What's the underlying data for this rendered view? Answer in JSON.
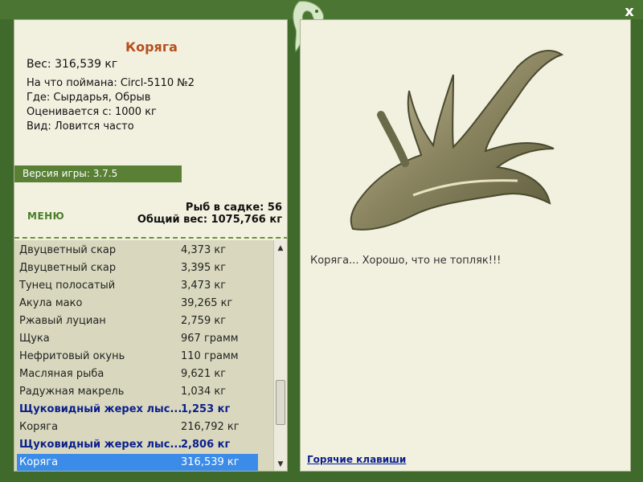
{
  "window": {
    "close_label": "x"
  },
  "catch": {
    "title": "Коряга",
    "weight": "Вес: 316,539 кг",
    "caught_on": "На что поймана: Circl-5110 №2",
    "location": "Где: Сырдарья, Обрыв",
    "value": "Оценивается с: 1000 кг",
    "kind": "Вид: Ловится часто",
    "caption": "Коряга... Хорошо, что не топляк!!!"
  },
  "version": "Версия игры: 3.7.5",
  "menu_label": "МЕНЮ",
  "stats": {
    "fish_in_keepnet": "Рыб в садке: 56",
    "total_weight": "Общий вес: 1075,766 кг"
  },
  "fish_list": [
    {
      "name": "Двуцветный скар",
      "weight": "4,373 кг",
      "style": "normal"
    },
    {
      "name": "Двуцветный скар",
      "weight": "3,395 кг",
      "style": "normal"
    },
    {
      "name": "Тунец полосатый",
      "weight": "3,473 кг",
      "style": "normal"
    },
    {
      "name": "Акула мако",
      "weight": "39,265 кг",
      "style": "normal"
    },
    {
      "name": "Ржавый луциан",
      "weight": "2,759 кг",
      "style": "normal"
    },
    {
      "name": "Щука",
      "weight": "967 грамм",
      "style": "normal"
    },
    {
      "name": "Нефритовый окунь",
      "weight": "110 грамм",
      "style": "normal"
    },
    {
      "name": "Масляная рыба",
      "weight": "9,621 кг",
      "style": "normal"
    },
    {
      "name": "Радужная макрель",
      "weight": "1,034 кг",
      "style": "normal"
    },
    {
      "name": "Щуковидный жерех лыс...",
      "weight": "1,253 кг",
      "style": "bold"
    },
    {
      "name": "Коряга",
      "weight": "216,792 кг",
      "style": "normal"
    },
    {
      "name": "Щуковидный жерех лыс...",
      "weight": "2,806 кг",
      "style": "bold"
    },
    {
      "name": "Коряга",
      "weight": "316,539 кг",
      "style": "selected"
    }
  ],
  "hotkeys_label": "Горячие клавиши",
  "icons": [
    "close-icon",
    "logo-icon",
    "scroll-up-icon",
    "scroll-down-icon"
  ],
  "colors": {
    "frame": "#3f6a2c",
    "panel": "#f2f1e0",
    "title": "#b5501e",
    "selection": "#3a8ce8",
    "bold_entry": "#0b1f8c"
  }
}
